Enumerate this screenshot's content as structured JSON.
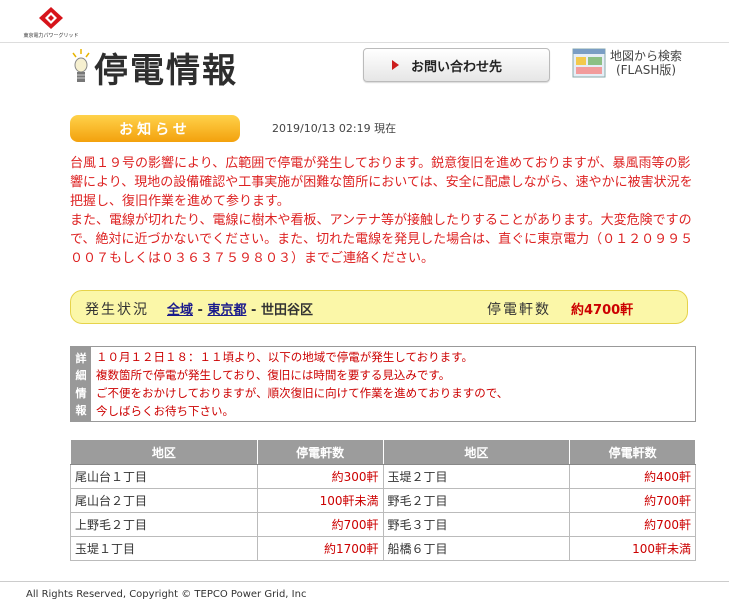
{
  "header": {
    "logo_text": "東京電力パワーグリッド",
    "title": "停電情報",
    "contact_label": "お問い合わせ先",
    "map_line1": "地図から検索",
    "map_line2": "(FLASH版)"
  },
  "notice": {
    "badge": "お知らせ",
    "timestamp": "2019/10/13 02:19 現在",
    "para1": "台風１９号の影響により、広範囲で停電が発生しております。鋭意復旧を進めておりますが、暴風雨等の影響により、現地の設備確認や工事実施が困難な箇所においては、安全に配慮しながら、速やかに被害状況を把握し、復旧作業を進めて参ります。",
    "para2": "また、電線が切れたり、電線に樹木や看板、アンテナ等が接触したりすることがあります。大変危険ですので、絶対に近づかないでください。また、切れた電線を発見した場合は、直ぐに東京電力（０１２０９９５００７もしくは０３６３７５９８０３）までご連絡ください。"
  },
  "status": {
    "label": "発生状況",
    "crumb_all": "全域",
    "sep": " - ",
    "crumb_pref": "東京都",
    "crumb_ward": "世田谷区",
    "count_label": "停電軒数",
    "count_value": "約4700軒"
  },
  "detail": {
    "label_chars": [
      "詳",
      "細",
      "情",
      "報"
    ],
    "lines": [
      "１０月１２日１８：１１頃より、以下の地域で停電が発生しております。",
      "複数箇所で停電が発生しており、復旧には時間を要する見込みです。",
      "ご不便をおかけしておりますが、順次復旧に向けて作業を進めておりますので、",
      "今しばらくお待ち下さい。"
    ]
  },
  "table": {
    "headers": [
      "地区",
      "停電軒数",
      "地区",
      "停電軒数"
    ],
    "rows": [
      [
        "尾山台１丁目",
        "約300軒",
        "玉堤２丁目",
        "約400軒"
      ],
      [
        "尾山台２丁目",
        "100軒未満",
        "野毛２丁目",
        "約700軒"
      ],
      [
        "上野毛２丁目",
        "約700軒",
        "野毛３丁目",
        "約700軒"
      ],
      [
        "玉堤１丁目",
        "約1700軒",
        "船橋６丁目",
        "100軒未満"
      ]
    ]
  },
  "footer": {
    "copyright": "All Rights Reserved, Copyright © TEPCO Power Grid, Inc"
  },
  "colors": {
    "accent_red": "#cc1e1e",
    "notice_text": "#dd2222",
    "badge_orange": "#f3a10d",
    "status_yellow": "#fbf7a8"
  }
}
